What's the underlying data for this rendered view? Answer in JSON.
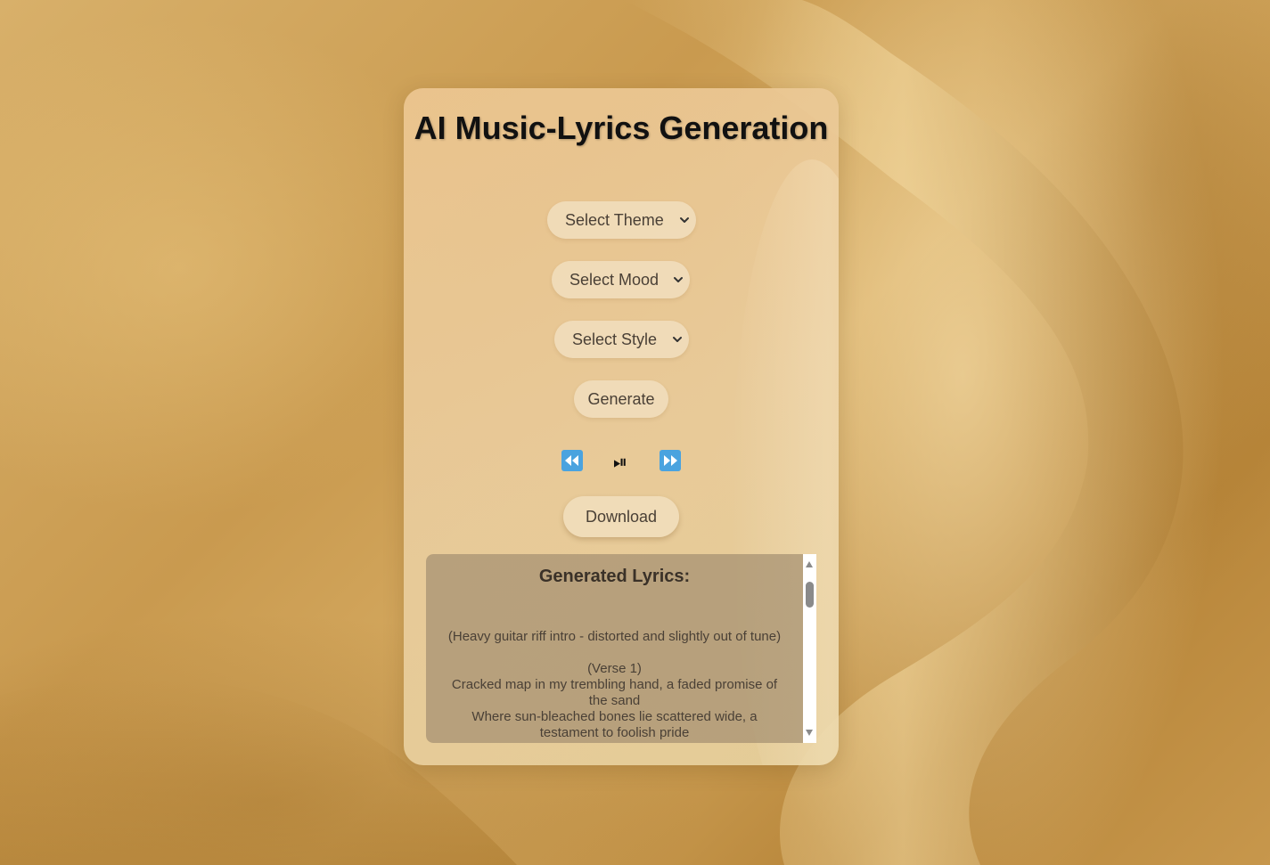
{
  "app": {
    "title": "AI Music-Lyrics Generation"
  },
  "selects": {
    "theme": {
      "selected": "Select Theme"
    },
    "mood": {
      "selected": "Select Mood"
    },
    "style": {
      "selected": "Select Style"
    }
  },
  "buttons": {
    "generate_label": "Generate",
    "download_label": "Download"
  },
  "player": {
    "rewind_icon": "rewind-icon",
    "play_pause_icon": "play-pause-icon",
    "play_pause_glyph": "⏯",
    "fast_forward_icon": "fast-forward-icon",
    "accent_color": "#4aa3df"
  },
  "lyrics": {
    "heading": "Generated Lyrics:",
    "text": "(Heavy guitar riff intro - distorted and slightly out of tune)\n\n(Verse 1)\nCracked map in my trembling hand, a faded promise of the sand\nWhere sun-bleached bones lie scattered wide, a testament to foolish pride"
  },
  "colors": {
    "background": "#c99a4f",
    "card": "#e8cc9a",
    "pill": "#f0dcb9",
    "text": "#4a4036"
  }
}
